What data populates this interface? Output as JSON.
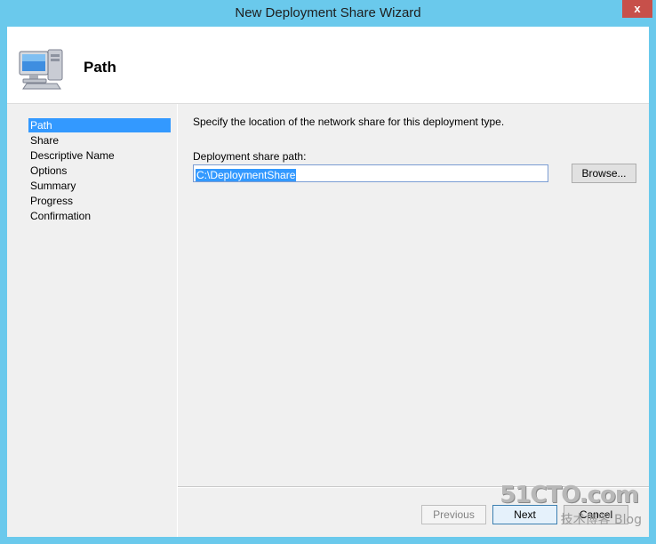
{
  "window": {
    "title": "New Deployment Share Wizard",
    "close_label": "x"
  },
  "header": {
    "title": "Path",
    "icon": "computer-icon"
  },
  "sidebar": {
    "items": [
      {
        "label": "Path",
        "selected": true
      },
      {
        "label": "Share",
        "selected": false
      },
      {
        "label": "Descriptive Name",
        "selected": false
      },
      {
        "label": "Options",
        "selected": false
      },
      {
        "label": "Summary",
        "selected": false
      },
      {
        "label": "Progress",
        "selected": false
      },
      {
        "label": "Confirmation",
        "selected": false
      }
    ]
  },
  "main": {
    "instruction": "Specify the location of the network share for this deployment type.",
    "path_label": "Deployment share path:",
    "path_value": "C:\\DeploymentShare",
    "browse_label": "Browse..."
  },
  "footer": {
    "previous_label": "Previous",
    "next_label": "Next",
    "cancel_label": "Cancel"
  },
  "watermark": {
    "line1": "51CTO.com",
    "line2": "技术博客  Blog"
  },
  "colors": {
    "title_bar": "#6ac9ec",
    "selection": "#3399ff",
    "close_button": "#c7504a"
  }
}
